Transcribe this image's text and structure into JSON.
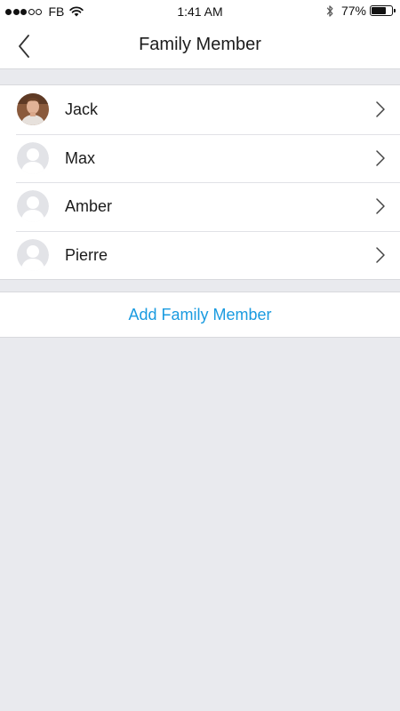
{
  "status_bar": {
    "carrier": "FB",
    "time": "1:41 AM",
    "battery_percent_label": "77%",
    "battery_level": 0.77,
    "signal_bars_filled": 3,
    "signal_bars_total": 5,
    "icons": [
      "signal-dots-icon",
      "wifi-icon",
      "bluetooth-icon",
      "battery-icon"
    ]
  },
  "nav": {
    "title": "Family Member",
    "back_icon": "chevron-left-icon"
  },
  "members": [
    {
      "name": "Jack",
      "avatar": "photo"
    },
    {
      "name": "Max",
      "avatar": "placeholder"
    },
    {
      "name": "Amber",
      "avatar": "placeholder"
    },
    {
      "name": "Pierre",
      "avatar": "placeholder"
    }
  ],
  "add_member": {
    "label": "Add Family Member",
    "color": "#1a9be0"
  },
  "colors": {
    "background": "#e9eaee",
    "surface": "#ffffff",
    "separator": "#e1e2e6",
    "accent": "#1a9be0"
  }
}
